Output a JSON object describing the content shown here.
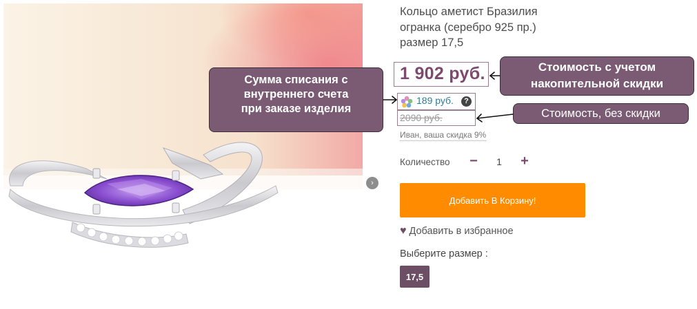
{
  "product": {
    "title_line1": "Кольцо аметист Бразилия",
    "title_line2": "огранка (серебро 925 пр.)",
    "title_line3": "размер 17,5",
    "price": "1 902 руб.",
    "bonus_value": "189 руб.",
    "old_price": "2090 руб.",
    "discount_note": "Иван, ваша скидка 9%"
  },
  "quantity": {
    "label": "Количество",
    "minus": "−",
    "value": "1",
    "plus": "+"
  },
  "actions": {
    "add_to_cart": "Добавить В Корзину!",
    "add_to_favorites": "Добавить в избранное",
    "heart_icon": "♥"
  },
  "size": {
    "label": "Выберите размер :",
    "option": "17,5"
  },
  "gallery": {
    "next_icon": "›",
    "help_icon": "?"
  },
  "annotations": {
    "bonus_line1": "Сумма списания с",
    "bonus_line2": "внутреннего счета",
    "bonus_line3": "при заказе изделия",
    "price_line1": "Стоимость с учетом",
    "price_line2": "накопительной скидки",
    "old_price": "Стоимость, без скидки"
  },
  "colors": {
    "accent": "#7c4a6e",
    "cart_button": "#ff8c00",
    "callout": "#7a5b73",
    "bonus_link": "#2c7e9c"
  }
}
